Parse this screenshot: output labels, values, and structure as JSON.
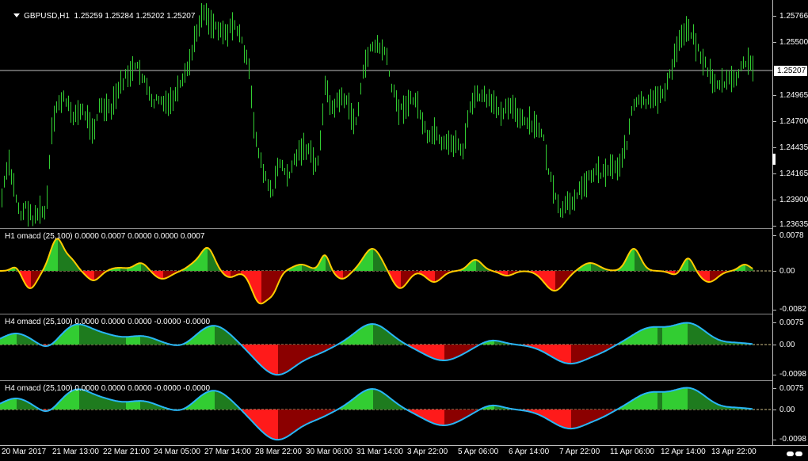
{
  "main_chart": {
    "symbol_label": "GBPUSD,H1",
    "ohlc_text": "1.25259 1.25284 1.25202 1.25207",
    "price_ticks": [
      "1.25766",
      "1.25500",
      "1.25207",
      "1.24965",
      "1.24700",
      "1.24435",
      "1.24165",
      "1.23900",
      "1.23635"
    ],
    "current_price": "1.25207",
    "line_color": "#32cd32",
    "price_line_color": "#c0c0c0"
  },
  "indicators": [
    {
      "label": "H1 omacd (25,100) 0.0000 0.0007 0.0000 0.0000 0.0007",
      "ticks": [
        "0.0078",
        "0.00",
        "-0.0082"
      ]
    },
    {
      "label": "H4 omacd (25,100) 0.0000 0.0000 0.0000 -0.0000 -0.0000",
      "ticks": [
        "0.0075",
        "0.00",
        "-0.0098"
      ]
    },
    {
      "label": "H4 omacd (25,100) 0.0000 0.0000 0.0000 -0.0000 -0.0000",
      "ticks": [
        "0.0075",
        "0.00",
        "-0.0098"
      ]
    }
  ],
  "colors": {
    "up_bright": "#32cd32",
    "up_dark": "#1e7b1e",
    "down_bright": "#ff1a1a",
    "down_dark": "#8b0000",
    "signal_h1": "#ffcc00",
    "signal_h4": "#29b6f6",
    "zero_line": "#d4c48a"
  },
  "time_axis": [
    "20 Mar 2017",
    "21 Mar 13:00",
    "22 Mar 21:00",
    "24 Mar 05:00",
    "27 Mar 14:00",
    "28 Mar 22:00",
    "30 Mar 06:00",
    "31 Mar 14:00",
    "3 Apr 22:00",
    "5 Apr 06:00",
    "6 Apr 14:00",
    "7 Apr 22:00",
    "11 Apr 06:00",
    "12 Apr 14:00",
    "13 Apr 22:00"
  ]
}
